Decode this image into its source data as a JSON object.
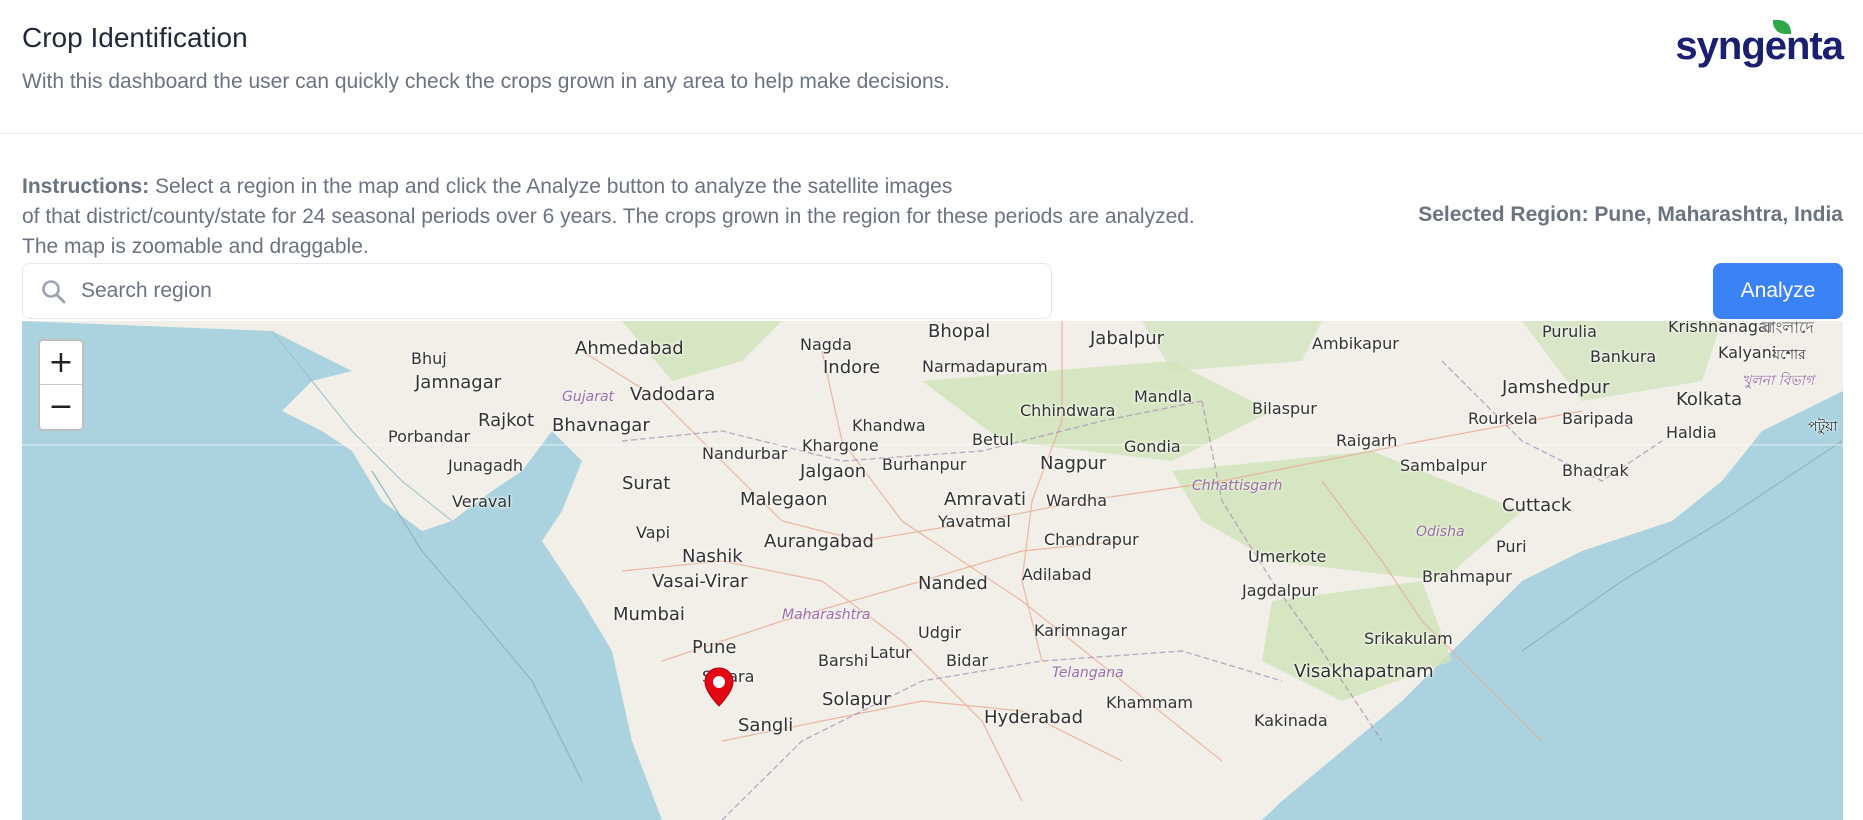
{
  "header": {
    "title": "Crop Identification",
    "subtitle": "With this dashboard the user can quickly check the crops grown in any area to help make decisions.",
    "logo_text": "syngenta"
  },
  "instructions": {
    "label": "Instructions:",
    "text": " Select a region in the map and click the Analyze button to analyze the satellite images",
    "line2": "of that district/county/state for 24 seasonal periods over 6 years. The crops grown in the region for these periods are analyzed.",
    "line3": "The map is zoomable and draggable."
  },
  "selected_region": "Selected Region: Pune, Maharashtra, India",
  "search": {
    "placeholder": "Search region",
    "value": ""
  },
  "analyze_label": "Analyze",
  "map": {
    "zoom_in": "+",
    "zoom_out": "−",
    "marker_icon": "map-pin-icon",
    "cities": [
      "Bhopal",
      "Jabalpur",
      "Nagda",
      "Ahmedabad",
      "Bhuj",
      "Jamnagar",
      "Indore",
      "Narmadapuram",
      "Vadodara",
      "Rajkot",
      "Bhavnagar",
      "Porbandar",
      "Junagadh",
      "Veraval",
      "Khandwa",
      "Khargone",
      "Nandurbar",
      "Burhanpur",
      "Betul",
      "Chhindwara",
      "Mandla",
      "Bilaspur",
      "Ambikapur",
      "Purulia",
      "Bankura",
      "Krishnanagar",
      "Kalyani",
      "Jamshedpur",
      "Kolkata",
      "Haldia",
      "Rourkela",
      "Baripada",
      "Raigarh",
      "Sambalpur",
      "Bhadrak",
      "Gondia",
      "Nagpur",
      "Jalgaon",
      "Surat",
      "Malegaon",
      "Amravati",
      "Wardha",
      "Yavatmal",
      "Vapi",
      "Nashik",
      "Aurangabad",
      "Chandrapur",
      "Vasai-Virar",
      "Nanded",
      "Adilabad",
      "Mumbai",
      "Pune",
      "Satara",
      "Udgir",
      "Latur",
      "Barshi",
      "Bidar",
      "Karimnagar",
      "Solapur",
      "Sangli",
      "Hyderabad",
      "Khammam",
      "Kakinada",
      "Cuttack",
      "Puri",
      "Umerkote",
      "Brahmapur",
      "Jagdalpur",
      "Srikakulam",
      "Visakhapatnam"
    ],
    "states": [
      "Gujarat",
      "Chhattisgarh",
      "Odisha",
      "Maharashtra",
      "Telangana"
    ],
    "bengali_1": "বাংলাদে",
    "bengali_2": "যশোর",
    "bengali_3": "খুলনা বিভাগ",
    "bengali_4": "পটুয়া"
  }
}
